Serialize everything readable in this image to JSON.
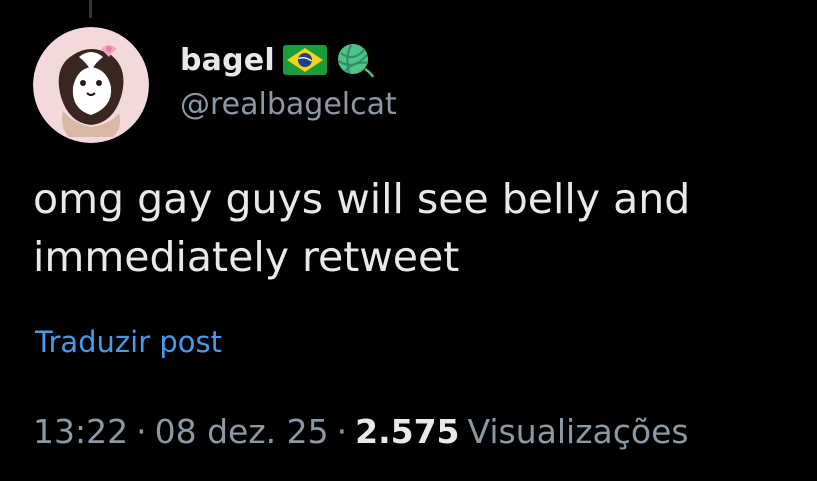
{
  "author": {
    "display_name": "bagel",
    "handle": "@realbagelcat",
    "name_icons": [
      "brazil-flag-icon",
      "yarn-ball-icon"
    ]
  },
  "tweet": {
    "text": "omg gay guys will see belly and immediately retweet",
    "translate_label": "Traduzir post"
  },
  "meta": {
    "time": "13:22",
    "separator": "·",
    "date": "08 dez. 25",
    "views_count": "2.575",
    "views_label": "Visualizações"
  },
  "colors": {
    "background": "#000000",
    "primary_text": "#e7e9ea",
    "secondary_text": "#8b98a5",
    "link": "#4a99e9",
    "yarn_green": "#4fc38a"
  }
}
